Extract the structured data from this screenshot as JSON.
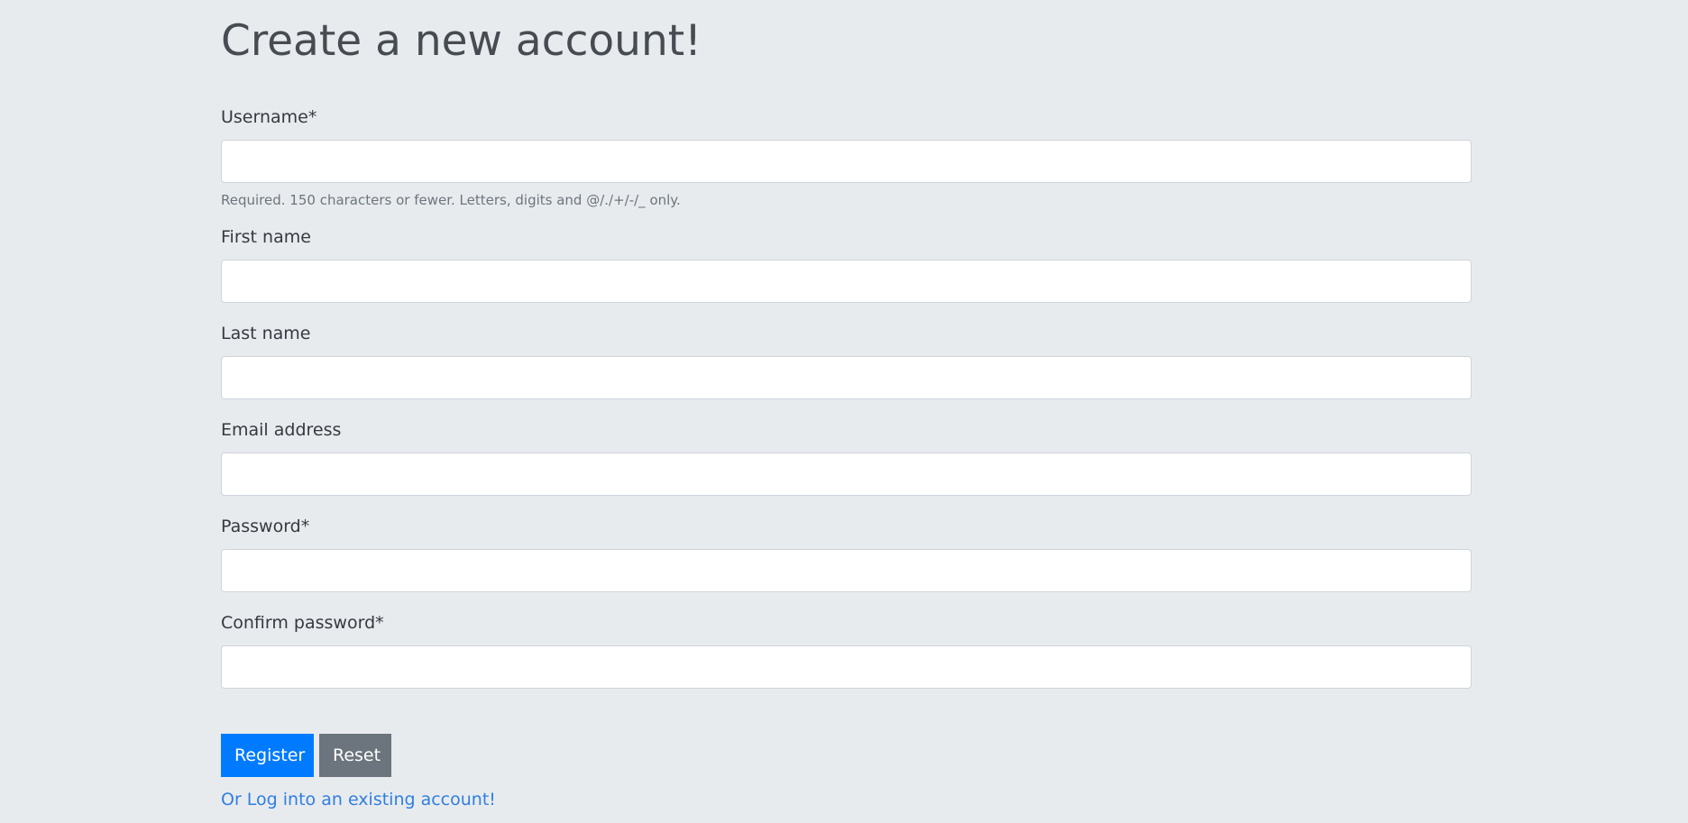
{
  "page": {
    "title": "Create a new account!"
  },
  "form": {
    "fields": [
      {
        "label": "Username*",
        "value": "",
        "placeholder": "",
        "help": "Required. 150 characters or fewer. Letters, digits and @/./+/-/_ only."
      },
      {
        "label": "First name",
        "value": "",
        "placeholder": ""
      },
      {
        "label": "Last name",
        "value": "",
        "placeholder": ""
      },
      {
        "label": "Email address",
        "value": "",
        "placeholder": ""
      },
      {
        "label": "Password*",
        "value": "",
        "placeholder": ""
      },
      {
        "label": "Confirm password*",
        "value": "",
        "placeholder": ""
      }
    ],
    "buttons": {
      "register_label": "Register",
      "reset_label": "Reset"
    },
    "login_link_text": "Or Log into an existing account!"
  },
  "colors": {
    "background": "#e8ebee",
    "primary": "#007bff",
    "secondary": "#6c757d",
    "link": "#2f7fe0"
  }
}
